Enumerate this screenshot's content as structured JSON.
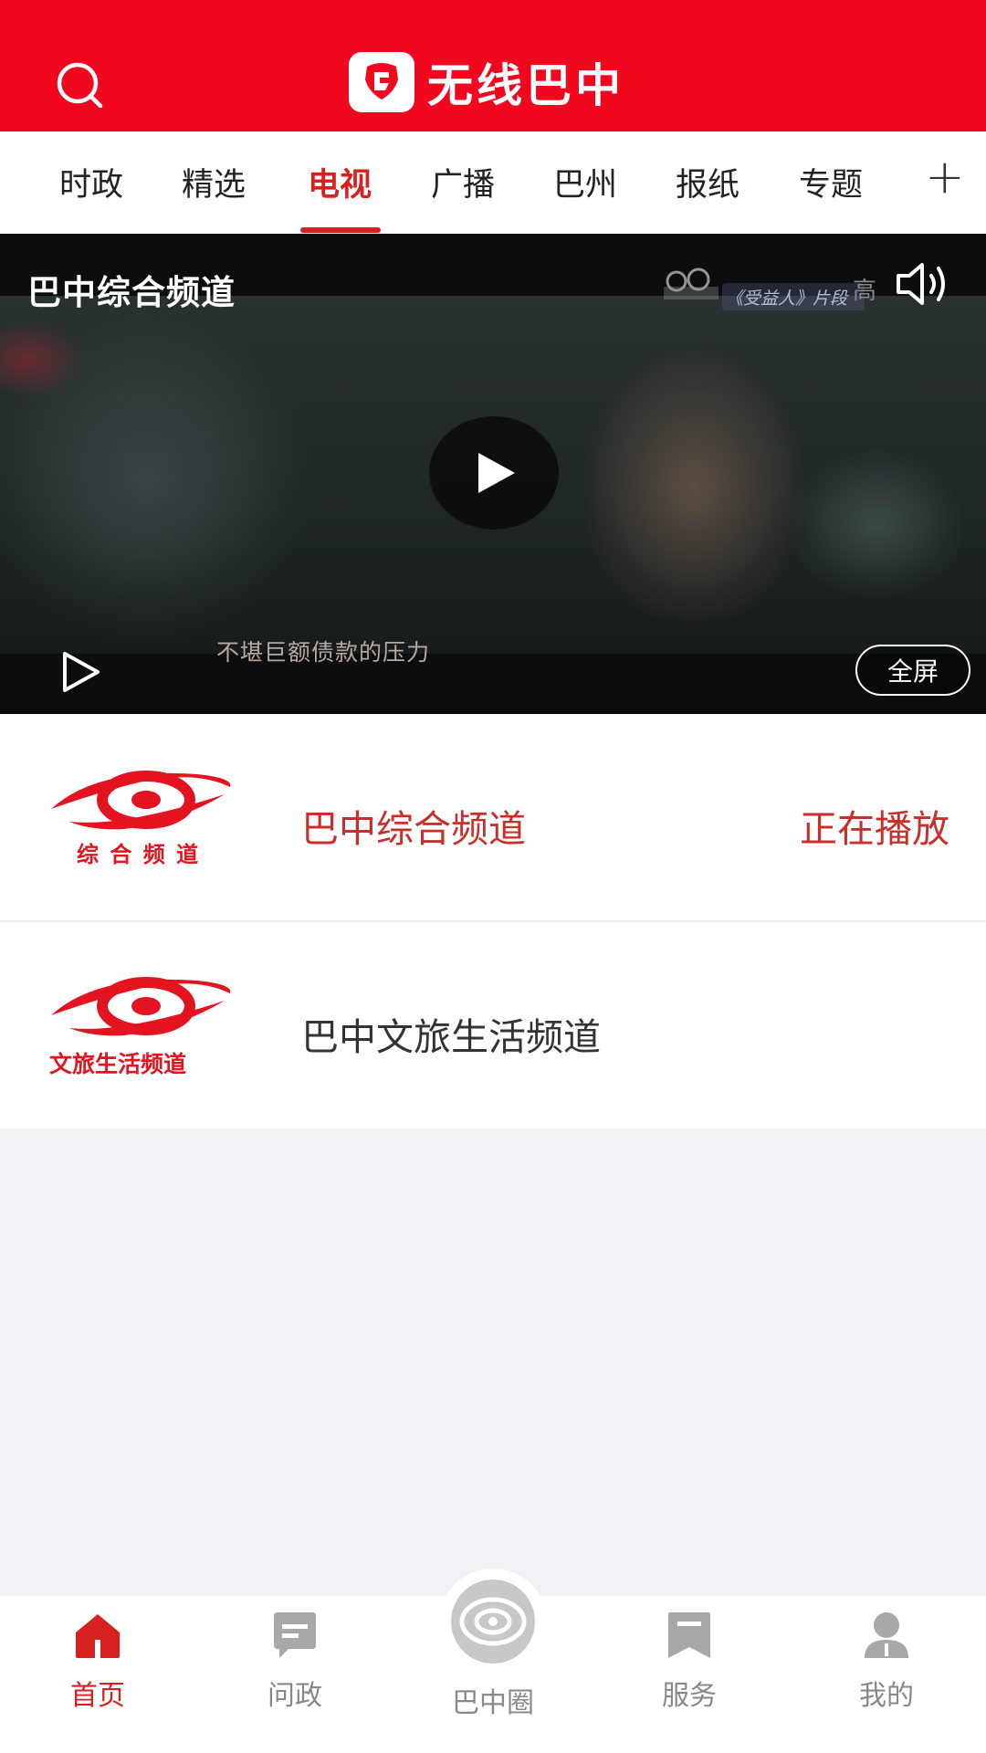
{
  "header": {
    "title": "无线巴中",
    "colors": {
      "brand": "#f2081e"
    }
  },
  "tabs": [
    {
      "label": "时政",
      "active": false
    },
    {
      "label": "精选",
      "active": false
    },
    {
      "label": "电视",
      "active": true
    },
    {
      "label": "广播",
      "active": false
    },
    {
      "label": "巴州",
      "active": false
    },
    {
      "label": "报纸",
      "active": false
    },
    {
      "label": "专题",
      "active": false
    }
  ],
  "tabs_more": "+",
  "player": {
    "channel_title": "巴中综合频道",
    "watermark_label": "《受益人》片段",
    "quality_label": "高",
    "subtitle": "不堪巨额债款的压力",
    "fullscreen_label": "全屏"
  },
  "channels": [
    {
      "logo_text": "综 合 频 道",
      "name": "巴中综合频道",
      "status": "正在播放"
    },
    {
      "logo_text": "文旅生活频道",
      "name": "巴中文旅生活频道",
      "status": ""
    }
  ],
  "bottom_nav": [
    {
      "label": "首页",
      "icon": "home-icon",
      "active": true
    },
    {
      "label": "问政",
      "icon": "message-icon",
      "active": false
    },
    {
      "label": "巴中圈",
      "icon": "circle-icon",
      "active": false
    },
    {
      "label": "服务",
      "icon": "bookmark-icon",
      "active": false
    },
    {
      "label": "我的",
      "icon": "user-icon",
      "active": false
    }
  ],
  "colors": {
    "accent": "#d7211e",
    "inactive": "#888888",
    "page_background": "#f2f2f6"
  }
}
